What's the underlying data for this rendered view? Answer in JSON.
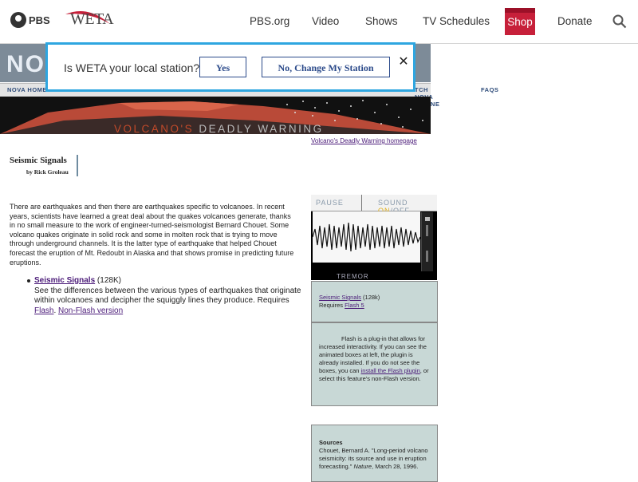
{
  "topbar": {
    "pbs_label": "PBS",
    "weta_label": "WETA",
    "nav": [
      "PBS.org",
      "Video",
      "Shows",
      "TV Schedules"
    ],
    "shop_label": "Shop",
    "donate_label": "Donate",
    "search_icon": "search-icon"
  },
  "popup": {
    "question": "Is WETA your local station?",
    "yes_label": "Yes",
    "change_label": "No, Change My Station",
    "close_label": "✕"
  },
  "nova": {
    "title": "NOV",
    "nav_items": [
      "NOVA HOME",
      "TCH NOVA ONLINE",
      "FAQS"
    ]
  },
  "banner": {
    "title_volcano": "VOLCANO'S",
    "title_rest": " DEADLY WARNING",
    "home_link": "Volcano's Deadly Warning homepage"
  },
  "article": {
    "title": "Seismic Signals",
    "byline": "by Rick Groleau",
    "body": "There are earthquakes and then there are earthquakes specific to volcanoes. In recent years, scientists have learned a great deal about the quakes volcanoes generate, thanks in no small measure to the work of engineer-turned-seismologist Bernard Chouet. Some volcano quakes originate in solid rock and some in molten rock that is trying to move through underground channels. It is the latter type of earthquake that helped Chouet forecast the eruption of Mt. Redoubt in Alaska and that shows promise in predicting future eruptions.",
    "bullet": {
      "link": "Seismic Signals",
      "size": " (128K)",
      "desc": "See the differences between the various types of earthquakes that originate within volcanoes and decipher the squiggly lines they produce. Requires ",
      "flash_link": "Flash",
      "sep": ". ",
      "nonflash_link": "Non-Flash version"
    }
  },
  "sidebar": {
    "flash_box": {
      "pause": "PAUSE",
      "sound_prefix": "SOUND ",
      "sound_on": "ON",
      "sound_suffix": "/OFF",
      "tremor": "TREMOR"
    },
    "info_box": {
      "link": "Seismic Signals",
      "size": " (128k)",
      "requires": "Requires ",
      "flash_link": "Flash 5"
    },
    "flash_note": {
      "text_before": "Flash is a plug-in that allows for increased interactivity. If you can see the animated boxes at left, the plugin is already installed. If you do not see the boxes, you can ",
      "install_link": "install the Flash plugin",
      "text_after": ", or select this feature's non-Flash version."
    },
    "sources": {
      "heading": "Sources",
      "text_before": "Chouet, Bernard A. \"Long-period volcano seismicity: its source and use in eruption forecasting.\" ",
      "journal": "Nature",
      "text_after": ", March 28, 1996."
    }
  },
  "colors": {
    "popup_border": "#2ea6e0",
    "shop_bg": "#c7203a",
    "nova_band": "#7d8b98",
    "sidebar_bg": "#c8d8d6",
    "link": "#4a1a78",
    "banner_red": "#c24a2a"
  }
}
